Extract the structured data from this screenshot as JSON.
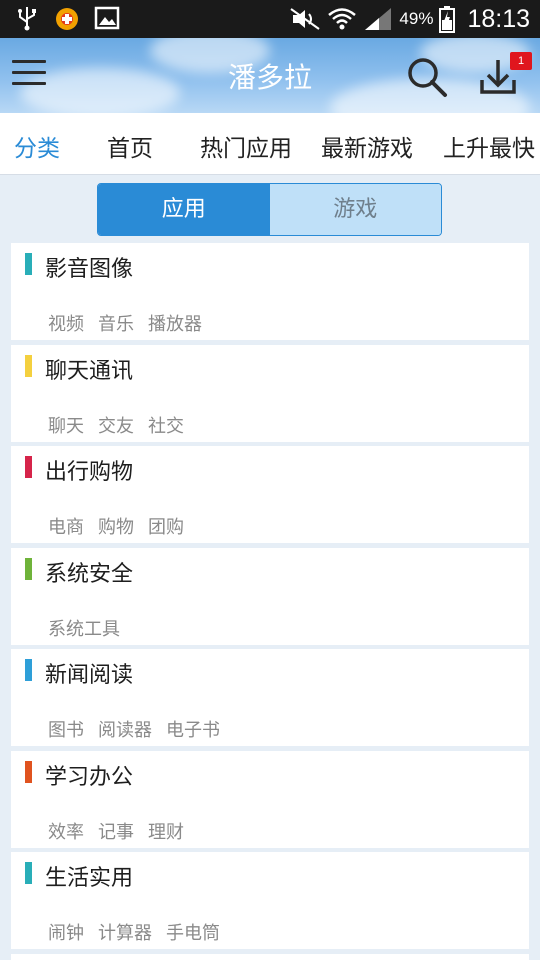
{
  "status_bar": {
    "battery": "49%",
    "time": "18:13",
    "icons": [
      "usb-icon",
      "app-notification-icon",
      "image-icon",
      "mute-icon",
      "wifi-icon",
      "signal-icon",
      "battery-icon"
    ]
  },
  "header": {
    "title": "潘多拉",
    "download_badge": "1",
    "icons": [
      "menu-icon",
      "search-icon",
      "download-icon"
    ]
  },
  "tabs": [
    {
      "label": "分类",
      "active": true
    },
    {
      "label": "首页",
      "active": false
    },
    {
      "label": "热门应用",
      "active": false
    },
    {
      "label": "最新游戏",
      "active": false
    },
    {
      "label": "上升最快",
      "active": false
    }
  ],
  "segment": {
    "apps": "应用",
    "games": "游戏"
  },
  "categories": [
    {
      "title": "影音图像",
      "color": "#29aeb8",
      "tags": [
        "视频",
        "音乐",
        "播放器"
      ]
    },
    {
      "title": "聊天通讯",
      "color": "#f4d03f",
      "tags": [
        "聊天",
        "交友",
        "社交"
      ]
    },
    {
      "title": "出行购物",
      "color": "#d6244a",
      "tags": [
        "电商",
        "购物",
        "团购"
      ]
    },
    {
      "title": "系统安全",
      "color": "#6fb33a",
      "tags": [
        "系统工具"
      ]
    },
    {
      "title": "新闻阅读",
      "color": "#2e9fd8",
      "tags": [
        "图书",
        "阅读器",
        "电子书"
      ]
    },
    {
      "title": "学习办公",
      "color": "#e0531f",
      "tags": [
        "效率",
        "记事",
        "理财"
      ]
    },
    {
      "title": "生活实用",
      "color": "#29aeb8",
      "tags": [
        "闹钟",
        "计算器",
        "手电筒"
      ]
    }
  ]
}
